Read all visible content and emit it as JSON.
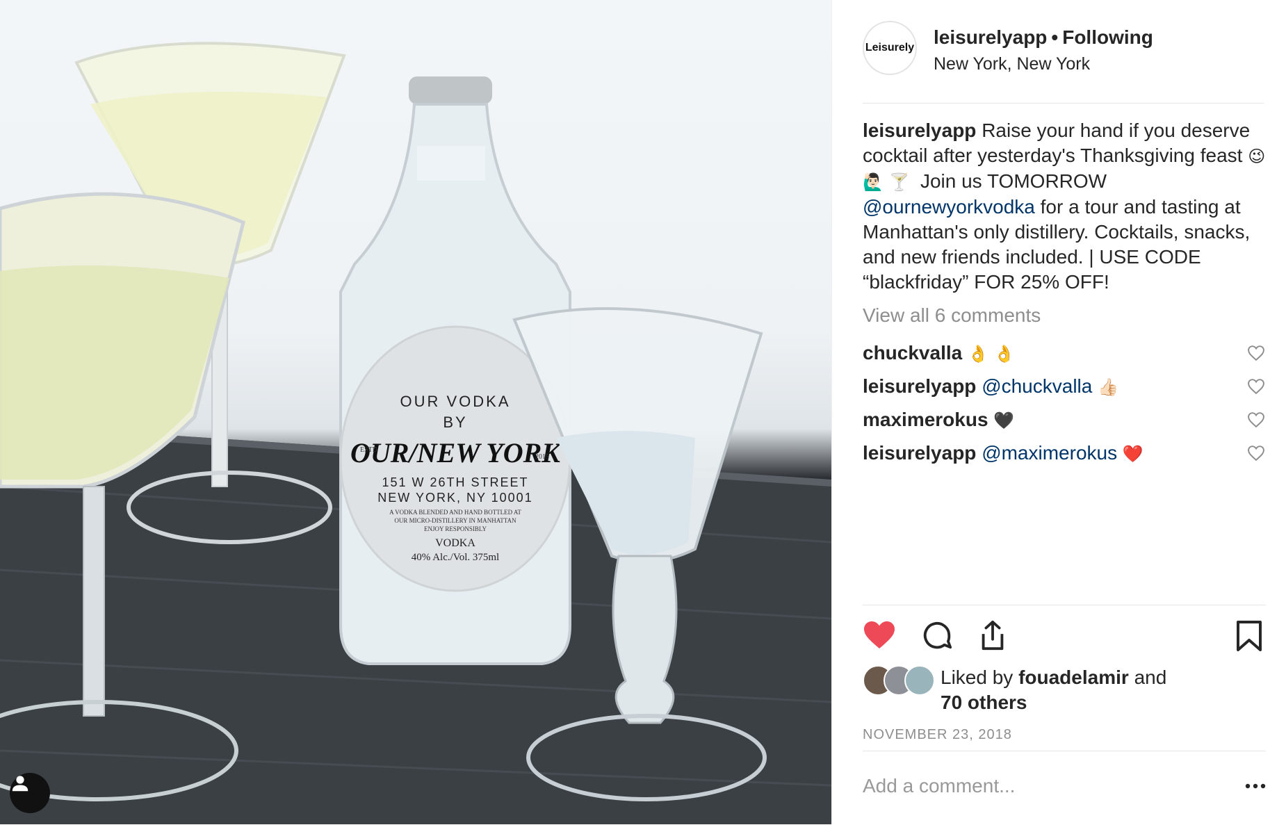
{
  "post": {
    "avatar_text": "Leisurely",
    "username": "leisurelyapp",
    "separator": "•",
    "follow_status": "Following",
    "location": "New York, New York",
    "caption": {
      "username": "leisurelyapp",
      "text1": "Raise your hand if you deserve cocktail after yesterday's Thanksgiving feast",
      "emojis": "😉 🙋🏻‍♂️ 🍸",
      "text2": "Join us TOMORROW",
      "mention": "@ournewyorkvodka",
      "text3": "for a tour and tasting at Manhattan's only distillery. Cocktails, snacks, and new friends included. | USE CODE “blackfriday” FOR 25% OFF!"
    },
    "view_all_comments": "View all 6 comments",
    "comments": [
      {
        "user": "chuckvalla",
        "mention": "",
        "text": "👌 👌"
      },
      {
        "user": "leisurelyapp",
        "mention": "@chuckvalla",
        "text": "👍🏻"
      },
      {
        "user": "maximerokus",
        "mention": "",
        "text": "🖤"
      },
      {
        "user": "leisurelyapp",
        "mention": "@maximerokus",
        "text": "❤️"
      }
    ],
    "likes": {
      "prefix": "Liked by",
      "user": "fouadelamir",
      "and": "and",
      "others": "70 others"
    },
    "date": "NOVEMBER 23, 2018",
    "comment_placeholder": "Add a comment...",
    "like_color": "#ed4956"
  },
  "photo": {
    "label_lines": [
      "OUR VODKA",
      "BY"
    ],
    "brand": "OUR/NEW YORK",
    "estd": "ESTD",
    "year": "2015",
    "address1": "151 W 26TH STREET",
    "address2": "NEW YORK, NY 10001",
    "fine1": "A VODKA BLENDED AND HAND BOTTLED AT",
    "fine2": "OUR MICRO-DISTILLERY IN MANHATTAN",
    "fine3": "ENJOY RESPONSIBLY",
    "product": "VODKA",
    "abv": "40% Alc./Vol. 375ml"
  }
}
